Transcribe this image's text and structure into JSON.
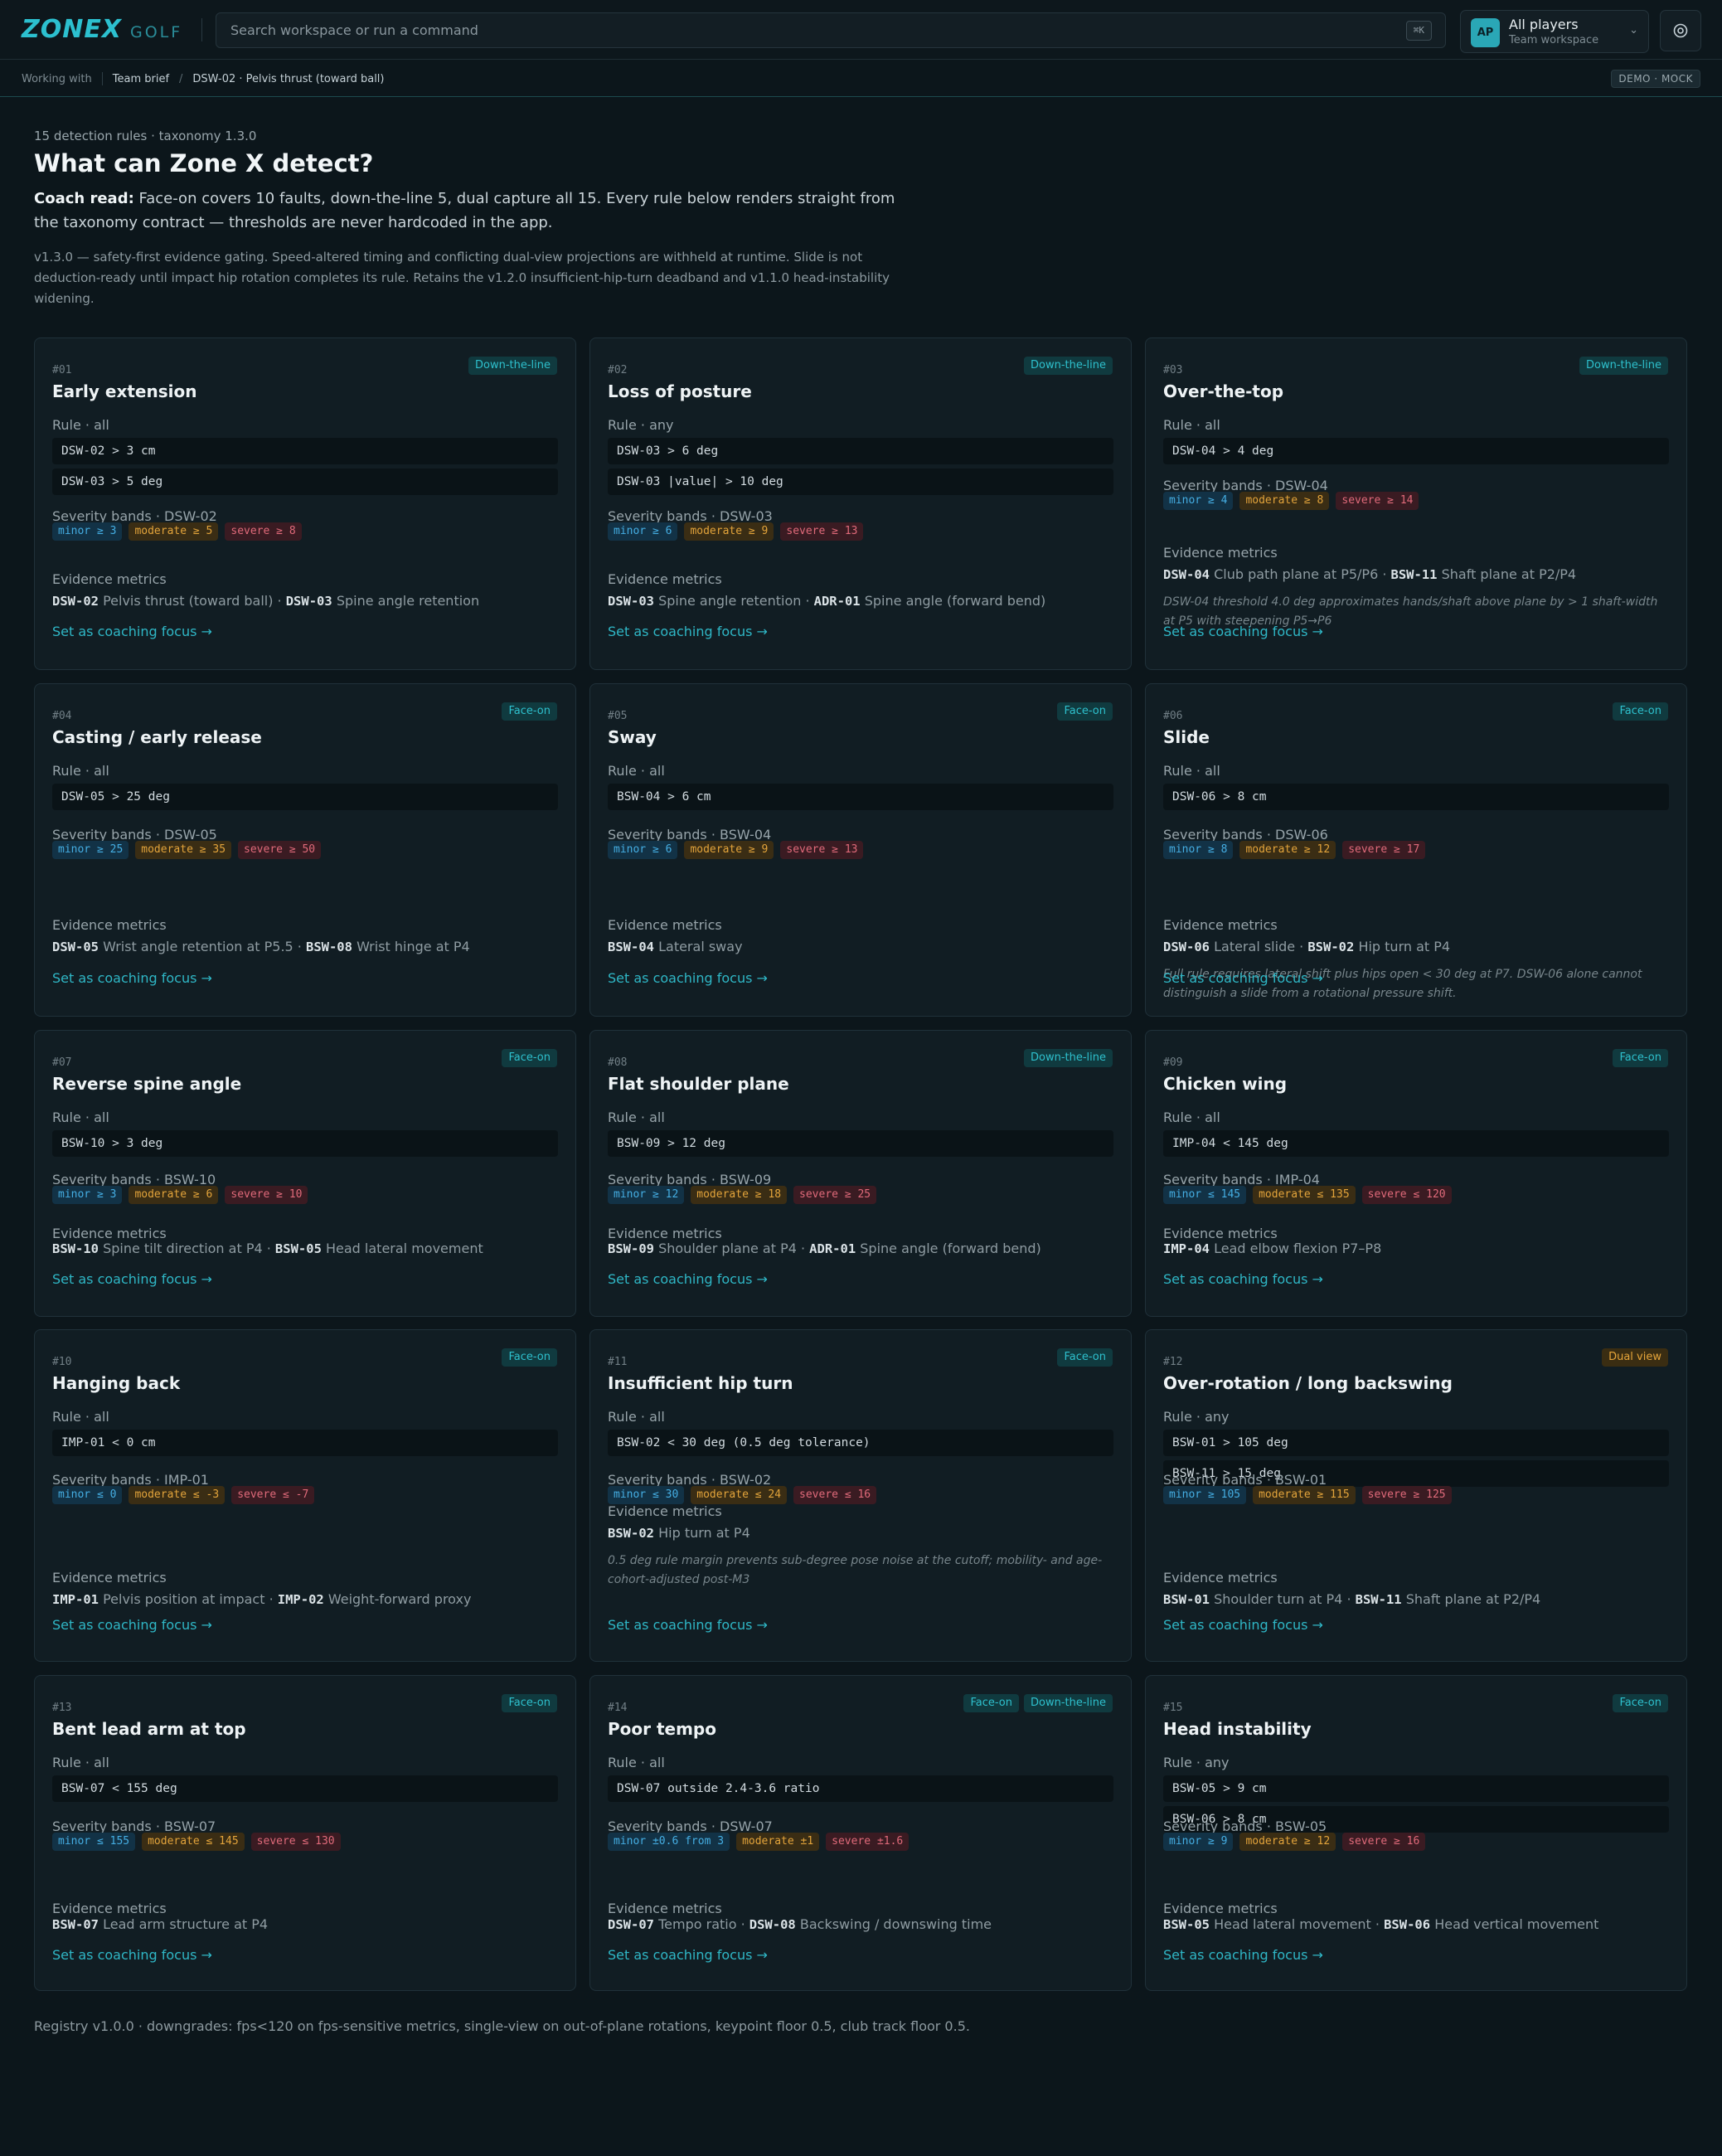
{
  "brand": {
    "name": "ZONEX",
    "sub": "GOLF"
  },
  "search": {
    "placeholder": "Search workspace or run a command",
    "shortcut": "⌘K"
  },
  "workspace": {
    "avatar": "AP",
    "title": "All players",
    "subtitle": "Team workspace"
  },
  "breadcrumb": {
    "lead": "Working with",
    "items": [
      "Team brief",
      "DSW-02 · Pelvis thrust (toward ball)"
    ],
    "badge": "DEMO · MOCK"
  },
  "intro": {
    "eyebrow": "15 detection rules · taxonomy 1.3.0",
    "title": "What can Zone X detect?",
    "coach_label": "Coach read:",
    "coach_text": " Face-on covers 10 faults, down-the-line 5, dual capture all 15. Every rule below renders straight from the taxonomy contract — thresholds are never hardcoded in the app.",
    "note": "v1.3.0 — safety-first evidence gating. Speed-altered timing and conflicting dual-view projections are withheld at runtime. Slide is not deduction-ready until impact hip rotation completes its rule. Retains the v1.2.0 insufficient-hip-turn deadband and v1.1.0 head-instability widening."
  },
  "labels": {
    "severity_prefix": "Severity bands · ",
    "evidence": "Evidence metrics",
    "focus": "Set as coaching focus →"
  },
  "colors": {
    "accent": "#2cc0cf",
    "minor": "#45aee3",
    "moderate": "#e3a43b",
    "severe": "#e06a7a",
    "dual": "#e6a53a"
  },
  "cards": [
    {
      "num": "#01",
      "title": "Early extension",
      "views": [
        "Down-the-line"
      ],
      "rule_mode": "Rule · all",
      "rules": [
        "DSW-02 > 3 cm",
        "DSW-03 > 5 deg"
      ],
      "band_metric": "DSW-02",
      "bands": [
        "minor ≥ 3",
        "moderate ≥ 5",
        "severe ≥ 8"
      ],
      "metrics": [
        {
          "code": "DSW-02",
          "label": "Pelvis thrust (toward ball)"
        },
        {
          "code": "DSW-03",
          "label": "Spine angle retention"
        }
      ],
      "note": ""
    },
    {
      "num": "#02",
      "title": "Loss of posture",
      "views": [
        "Down-the-line"
      ],
      "rule_mode": "Rule · any",
      "rules": [
        "DSW-03 > 6 deg",
        "DSW-03 |value| > 10 deg"
      ],
      "band_metric": "DSW-03",
      "bands": [
        "minor ≥ 6",
        "moderate ≥ 9",
        "severe ≥ 13"
      ],
      "metrics": [
        {
          "code": "DSW-03",
          "label": "Spine angle retention"
        },
        {
          "code": "ADR-01",
          "label": "Spine angle (forward bend)"
        }
      ],
      "note": ""
    },
    {
      "num": "#03",
      "title": "Over-the-top",
      "views": [
        "Down-the-line"
      ],
      "rule_mode": "Rule · all",
      "rules": [
        "DSW-04 > 4 deg"
      ],
      "band_metric": "DSW-04",
      "bands": [
        "minor ≥ 4",
        "moderate ≥ 8",
        "severe ≥ 14"
      ],
      "metrics": [
        {
          "code": "DSW-04",
          "label": "Club path plane at P5/P6"
        },
        {
          "code": "BSW-11",
          "label": "Shaft plane at P2/P4"
        }
      ],
      "note": "DSW-04 threshold 4.0 deg approximates hands/shaft above plane by > 1 shaft-width at P5 with steepening P5→P6"
    },
    {
      "num": "#04",
      "title": "Casting / early release",
      "views": [
        "Face-on"
      ],
      "rule_mode": "Rule · all",
      "rules": [
        "DSW-05 > 25 deg"
      ],
      "band_metric": "DSW-05",
      "bands": [
        "minor ≥ 25",
        "moderate ≥ 35",
        "severe ≥ 50"
      ],
      "metrics": [
        {
          "code": "DSW-05",
          "label": "Wrist angle retention at P5.5"
        },
        {
          "code": "BSW-08",
          "label": "Wrist hinge at P4"
        }
      ],
      "note": ""
    },
    {
      "num": "#05",
      "title": "Sway",
      "views": [
        "Face-on"
      ],
      "rule_mode": "Rule · all",
      "rules": [
        "BSW-04 > 6 cm"
      ],
      "band_metric": "BSW-04",
      "bands": [
        "minor ≥ 6",
        "moderate ≥ 9",
        "severe ≥ 13"
      ],
      "metrics": [
        {
          "code": "BSW-04",
          "label": "Lateral sway"
        }
      ],
      "note": ""
    },
    {
      "num": "#06",
      "title": "Slide",
      "views": [
        "Face-on"
      ],
      "rule_mode": "Rule · all",
      "rules": [
        "DSW-06 > 8 cm"
      ],
      "band_metric": "DSW-06",
      "bands": [
        "minor ≥ 8",
        "moderate ≥ 12",
        "severe ≥ 17"
      ],
      "metrics": [
        {
          "code": "DSW-06",
          "label": "Lateral slide"
        },
        {
          "code": "BSW-02",
          "label": "Hip turn at P4"
        }
      ],
      "note": "Full rule requires lateral shift plus hips open < 30 deg at P7. DSW-06 alone cannot distinguish a slide from a rotational pressure shift."
    },
    {
      "num": "#07",
      "title": "Reverse spine angle",
      "views": [
        "Face-on"
      ],
      "rule_mode": "Rule · all",
      "rules": [
        "BSW-10 > 3 deg"
      ],
      "band_metric": "BSW-10",
      "bands": [
        "minor ≥ 3",
        "moderate ≥ 6",
        "severe ≥ 10"
      ],
      "metrics": [
        {
          "code": "BSW-10",
          "label": "Spine tilt direction at P4"
        },
        {
          "code": "BSW-05",
          "label": "Head lateral movement"
        }
      ],
      "note": ""
    },
    {
      "num": "#08",
      "title": "Flat shoulder plane",
      "views": [
        "Down-the-line"
      ],
      "rule_mode": "Rule · all",
      "rules": [
        "BSW-09 > 12 deg"
      ],
      "band_metric": "BSW-09",
      "bands": [
        "minor ≥ 12",
        "moderate ≥ 18",
        "severe ≥ 25"
      ],
      "metrics": [
        {
          "code": "BSW-09",
          "label": "Shoulder plane at P4"
        },
        {
          "code": "ADR-01",
          "label": "Spine angle (forward bend)"
        }
      ],
      "note": ""
    },
    {
      "num": "#09",
      "title": "Chicken wing",
      "views": [
        "Face-on"
      ],
      "rule_mode": "Rule · all",
      "rules": [
        "IMP-04 < 145 deg"
      ],
      "band_metric": "IMP-04",
      "bands": [
        "minor ≤ 145",
        "moderate ≤ 135",
        "severe ≤ 120"
      ],
      "metrics": [
        {
          "code": "IMP-04",
          "label": "Lead elbow flexion P7–P8"
        }
      ],
      "note": ""
    },
    {
      "num": "#10",
      "title": "Hanging back",
      "views": [
        "Face-on"
      ],
      "rule_mode": "Rule · all",
      "rules": [
        "IMP-01 < 0 cm"
      ],
      "band_metric": "IMP-01",
      "bands": [
        "minor ≤ 0",
        "moderate ≤ -3",
        "severe ≤ -7"
      ],
      "metrics": [
        {
          "code": "IMP-01",
          "label": "Pelvis position at impact"
        },
        {
          "code": "IMP-02",
          "label": "Weight-forward proxy"
        }
      ],
      "note": ""
    },
    {
      "num": "#11",
      "title": "Insufficient hip turn",
      "views": [
        "Face-on"
      ],
      "rule_mode": "Rule · all",
      "rules": [
        "BSW-02 < 30 deg (0.5 deg tolerance)"
      ],
      "band_metric": "BSW-02",
      "bands": [
        "minor ≤ 30",
        "moderate ≤ 24",
        "severe ≤ 16"
      ],
      "metrics": [
        {
          "code": "BSW-02",
          "label": "Hip turn at P4"
        }
      ],
      "note": "0.5 deg rule margin prevents sub-degree pose noise at the cutoff; mobility- and age-cohort-adjusted post-M3"
    },
    {
      "num": "#12",
      "title": "Over-rotation / long backswing",
      "views": [
        "Dual view"
      ],
      "rule_mode": "Rule · any",
      "rules": [
        "BSW-01 > 105 deg",
        "BSW-11 > 15 deg"
      ],
      "band_metric": "BSW-01",
      "bands": [
        "minor ≥ 105",
        "moderate ≥ 115",
        "severe ≥ 125"
      ],
      "metrics": [
        {
          "code": "BSW-01",
          "label": "Shoulder turn at P4"
        },
        {
          "code": "BSW-11",
          "label": "Shaft plane at P2/P4"
        }
      ],
      "note": ""
    },
    {
      "num": "#13",
      "title": "Bent lead arm at top",
      "views": [
        "Face-on"
      ],
      "rule_mode": "Rule · all",
      "rules": [
        "BSW-07 < 155 deg"
      ],
      "band_metric": "BSW-07",
      "bands": [
        "minor ≤ 155",
        "moderate ≤ 145",
        "severe ≤ 130"
      ],
      "metrics": [
        {
          "code": "BSW-07",
          "label": "Lead arm structure at P4"
        }
      ],
      "note": ""
    },
    {
      "num": "#14",
      "title": "Poor tempo",
      "views": [
        "Face-on",
        "Down-the-line"
      ],
      "rule_mode": "Rule · all",
      "rules": [
        "DSW-07 outside 2.4-3.6 ratio"
      ],
      "band_metric": "DSW-07",
      "bands": [
        "minor ±0.6 from 3",
        "moderate ±1",
        "severe ±1.6"
      ],
      "metrics": [
        {
          "code": "DSW-07",
          "label": "Tempo ratio"
        },
        {
          "code": "DSW-08",
          "label": "Backswing / downswing time"
        }
      ],
      "note": ""
    },
    {
      "num": "#15",
      "title": "Head instability",
      "views": [
        "Face-on"
      ],
      "rule_mode": "Rule · any",
      "rules": [
        "BSW-05 > 9 cm",
        "BSW-06 > 8 cm"
      ],
      "band_metric": "BSW-05",
      "bands": [
        "minor ≥ 9",
        "moderate ≥ 12",
        "severe ≥ 16"
      ],
      "metrics": [
        {
          "code": "BSW-05",
          "label": "Head lateral movement"
        },
        {
          "code": "BSW-06",
          "label": "Head vertical movement"
        }
      ],
      "note": ""
    }
  ],
  "footer": "Registry v1.0.0 · downgrades: fps<120 on fps-sensitive metrics, single-view on out-of-plane rotations, keypoint floor 0.5, club track floor 0.5."
}
